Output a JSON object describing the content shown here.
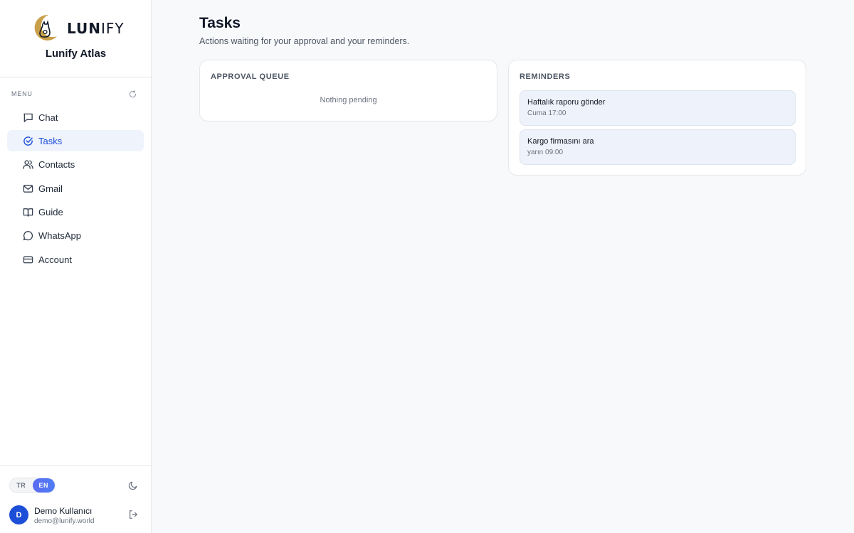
{
  "brand": {
    "wordmark_bold": "LUN",
    "wordmark_thin": "IFY",
    "title": "Lunify Atlas"
  },
  "sidebar": {
    "menu_label": "MENU",
    "items": [
      {
        "label": "Chat",
        "icon": "chat-icon"
      },
      {
        "label": "Tasks",
        "icon": "check-circle-icon",
        "active": true
      },
      {
        "label": "Contacts",
        "icon": "users-icon"
      },
      {
        "label": "Gmail",
        "icon": "mail-icon"
      },
      {
        "label": "Guide",
        "icon": "book-icon"
      },
      {
        "label": "WhatsApp",
        "icon": "whatsapp-icon"
      },
      {
        "label": "Account",
        "icon": "credit-card-icon"
      }
    ]
  },
  "footer": {
    "lang_tr": "TR",
    "lang_en": "EN",
    "lang_selected": "EN",
    "user_initial": "D",
    "user_name": "Demo Kullanıcı",
    "user_email": "demo@lunify.world"
  },
  "main": {
    "title": "Tasks",
    "subtitle": "Actions waiting for your approval and your reminders.",
    "approval": {
      "heading": "APPROVAL QUEUE",
      "empty": "Nothing pending"
    },
    "reminders": {
      "heading": "REMINDERS",
      "items": [
        {
          "title": "Haftalık raporu gönder",
          "time": "Cuma 17:00"
        },
        {
          "title": "Kargo firmasını ara",
          "time": "yarın 09:00"
        }
      ]
    }
  },
  "colors": {
    "accent": "#1d4ed8",
    "active_bg": "#eef3fc",
    "logo_gold": "#c9a04a"
  }
}
